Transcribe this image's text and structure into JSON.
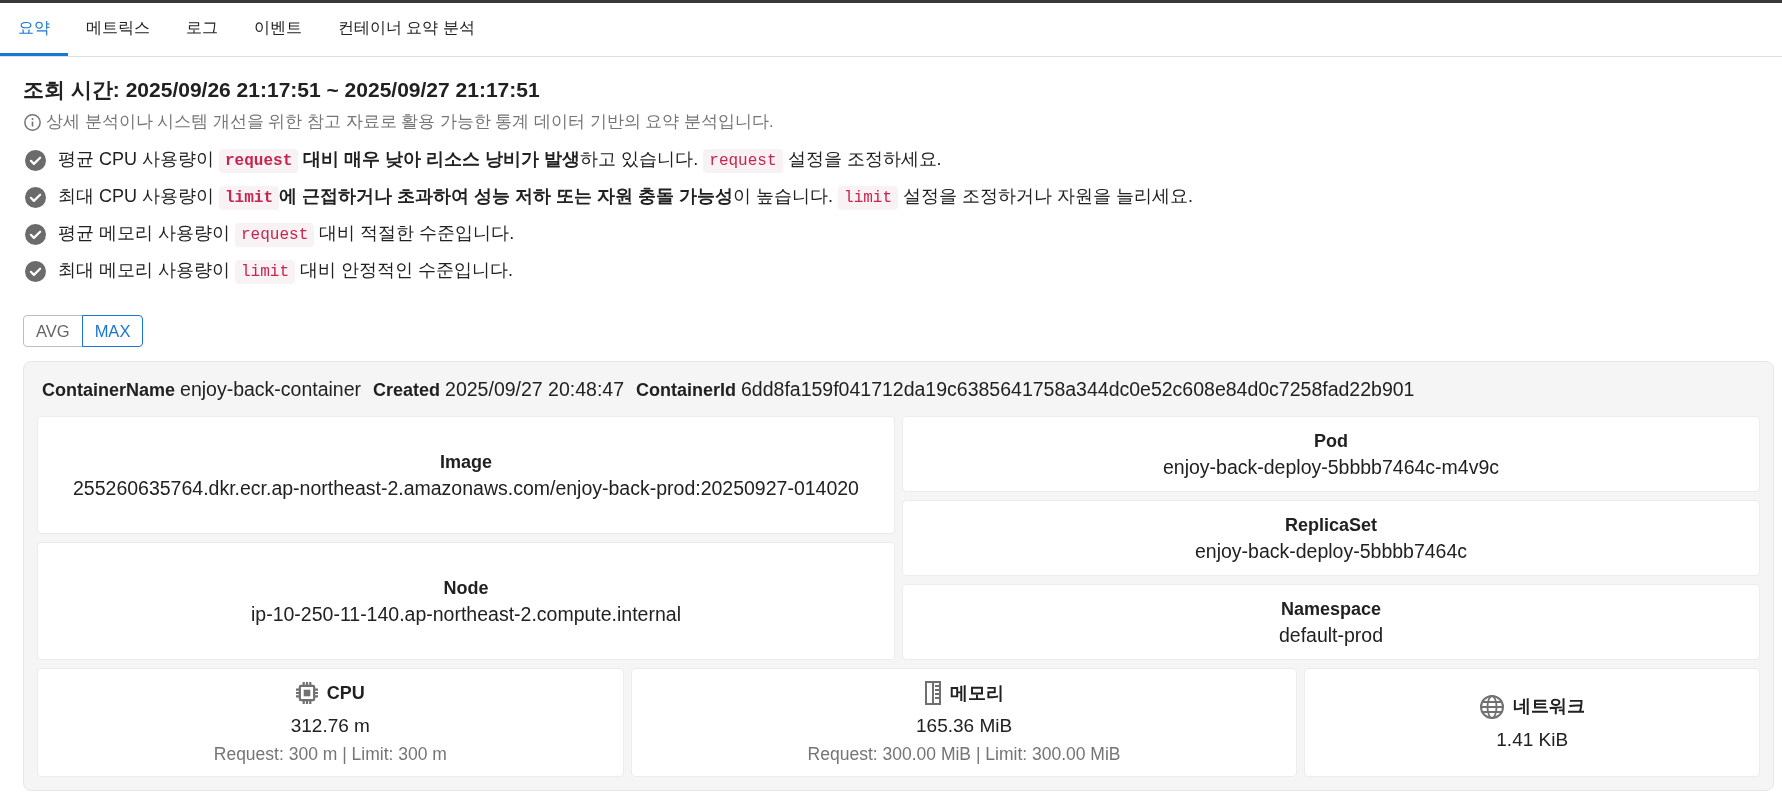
{
  "tabs": [
    {
      "label": "요약",
      "selected": true
    },
    {
      "label": "메트릭스",
      "selected": false
    },
    {
      "label": "로그",
      "selected": false
    },
    {
      "label": "이벤트",
      "selected": false
    },
    {
      "label": "컨테이너 요약 분석",
      "selected": false
    }
  ],
  "title": "조회 시간: 2025/09/26 21:17:51 ~ 2025/09/27 21:17:51",
  "notice": "상세 분석이나 시스템 개선을 위한 참고 자료로 활용 가능한 통계 데이터 기반의 요약 분석입니다.",
  "findings": [
    {
      "segments": [
        {
          "kind": "text",
          "text": "평균 CPU 사용량이 "
        },
        {
          "kind": "code",
          "text": "request",
          "bold": true
        },
        {
          "kind": "text",
          "text": " **대비 매우 낮아 리소스 낭비가 발생**하고 있습니다. "
        },
        {
          "kind": "code",
          "text": "request",
          "bold": false
        },
        {
          "kind": "text",
          "text": " 설정을 조정하세요."
        }
      ]
    },
    {
      "segments": [
        {
          "kind": "text",
          "text": "최대 CPU 사용량이 "
        },
        {
          "kind": "code",
          "text": "limit",
          "bold": true
        },
        {
          "kind": "text",
          "text": "**에 근접하거나 초과하여 성능 저하 또는 자원 충돌 가능성**이 높습니다. "
        },
        {
          "kind": "code",
          "text": "limit",
          "bold": false
        },
        {
          "kind": "text",
          "text": " 설정을 조정하거나 자원을 늘리세요."
        }
      ]
    },
    {
      "segments": [
        {
          "kind": "text",
          "text": "평균 메모리 사용량이 "
        },
        {
          "kind": "code",
          "text": "request",
          "bold": false
        },
        {
          "kind": "text",
          "text": " 대비 적절한 수준입니다."
        }
      ]
    },
    {
      "segments": [
        {
          "kind": "text",
          "text": "최대 메모리 사용량이 "
        },
        {
          "kind": "code",
          "text": "limit",
          "bold": false
        },
        {
          "kind": "text",
          "text": " 대비 안정적인 수준입니다."
        }
      ]
    }
  ],
  "aggregate_toggle": [
    {
      "label": "AVG",
      "selected": false
    },
    {
      "label": "MAX",
      "selected": true
    }
  ],
  "container": {
    "header": [
      {
        "label": "ContainerName",
        "value": "enjoy-back-container"
      },
      {
        "label": "Created",
        "value": "2025/09/27 20:48:47"
      },
      {
        "label": "ContainerId",
        "value": "6dd8fa159f041712da19c6385641758a344dc0e52c608e84d0c7258fad22b901"
      }
    ],
    "detail_columns": [
      [
        {
          "label": "Image",
          "value": "255260635764.dkr.ecr.ap-northeast-2.amazonaws.com/enjoy-back-prod:20250927-014020"
        },
        {
          "label": "Node",
          "value": "ip-10-250-11-140.ap-northeast-2.compute.internal"
        }
      ],
      [
        {
          "label": "Pod",
          "value": "enjoy-back-deploy-5bbbb7464c-m4v9c"
        },
        {
          "label": "ReplicaSet",
          "value": "enjoy-back-deploy-5bbbb7464c"
        },
        {
          "label": "Namespace",
          "value": "default-prod"
        }
      ]
    ],
    "resources": [
      {
        "kind": "cpu",
        "title": "CPU",
        "value": "312.76 m",
        "limits": "Request: 300 m | Limit: 300 m"
      },
      {
        "kind": "memory",
        "title": "메모리",
        "value": "165.36 MiB",
        "limits": "Request: 300.00 MiB | Limit: 300.00 MiB"
      },
      {
        "kind": "network",
        "title": "네트워크",
        "value": "1.41 KiB"
      }
    ]
  }
}
